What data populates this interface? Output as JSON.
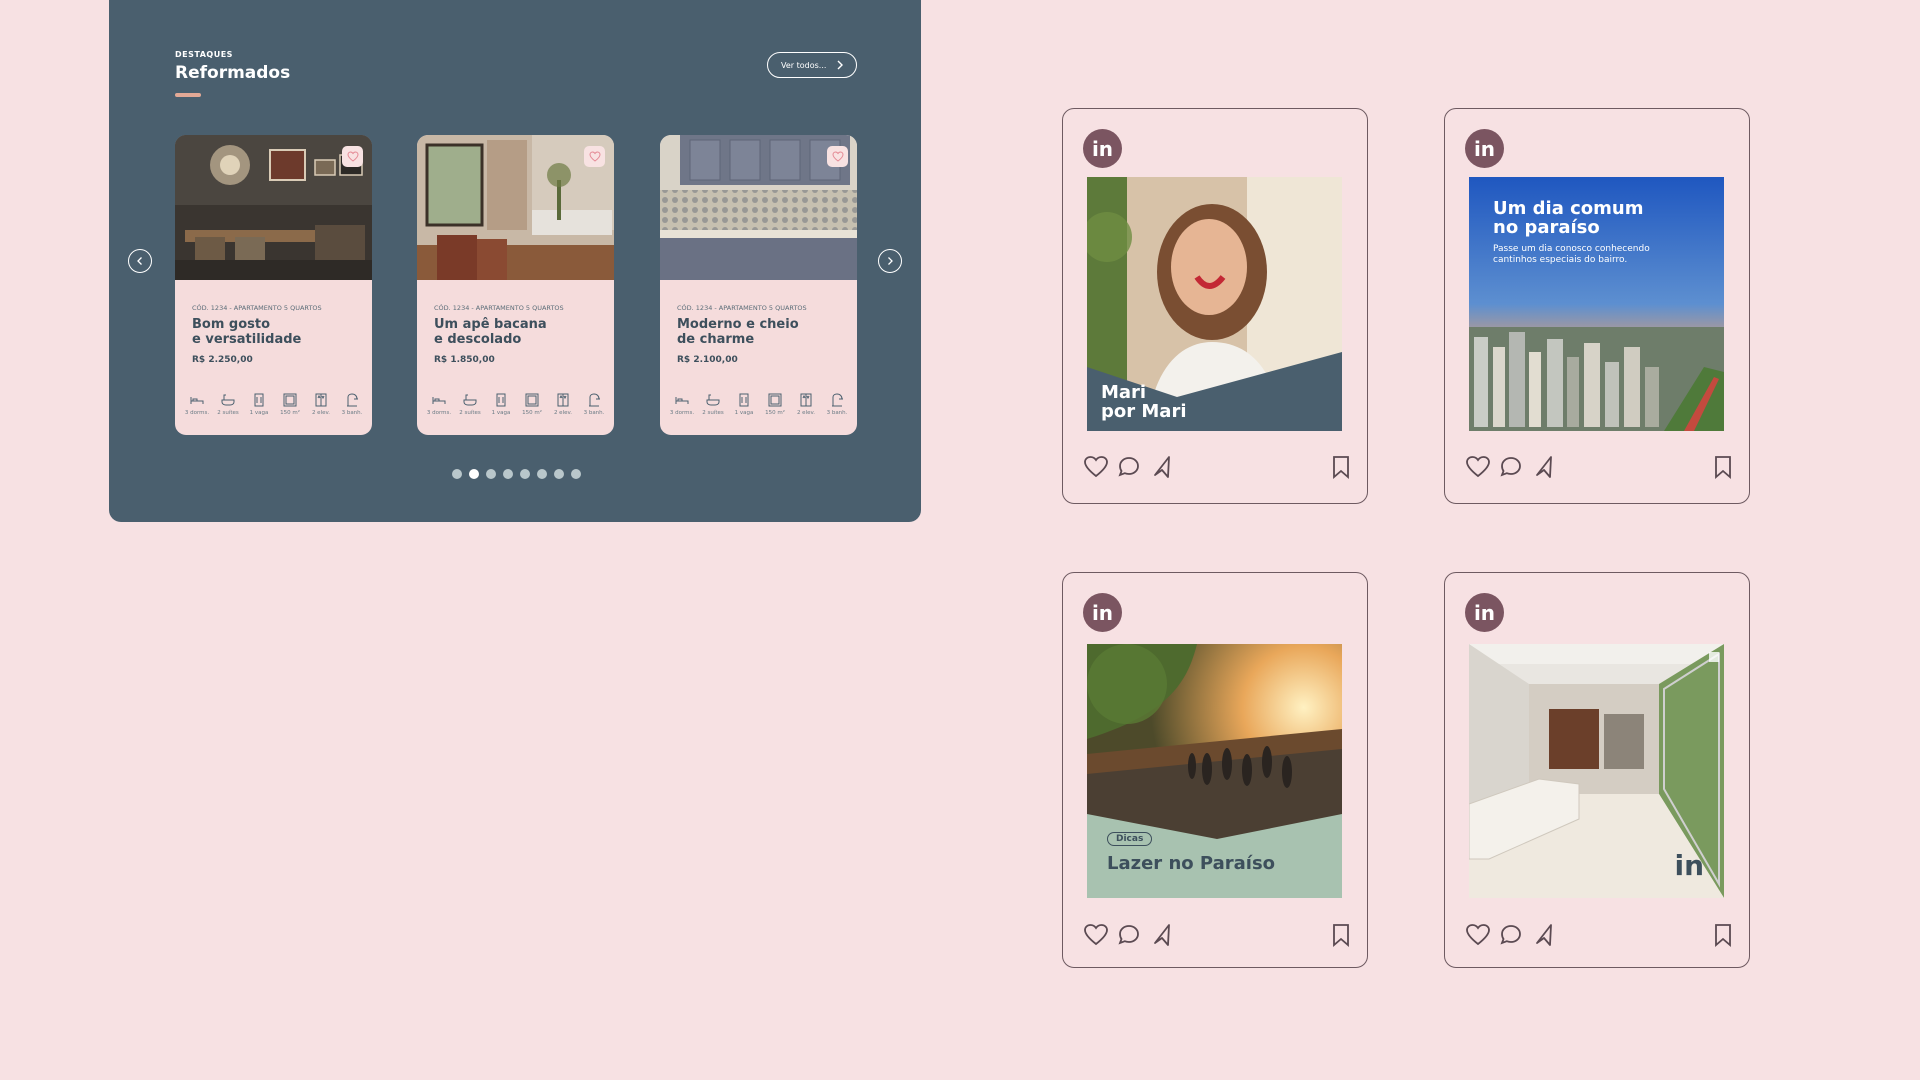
{
  "website": {
    "eyebrow": "DESTAQUES",
    "title": "Reformados",
    "see_all": "Ver todos...",
    "cards": [
      {
        "code": "CÓD. 1234  -  APARTAMENTO 5 QUARTOS",
        "title": "Bom gosto\ne versatilidade",
        "price": "R$ 2.250,00"
      },
      {
        "code": "CÓD. 1234  -  APARTAMENTO 5 QUARTOS",
        "title": "Um apê bacana\ne descolado",
        "price": "R$ 1.850,00"
      },
      {
        "code": "CÓD. 1234  -  APARTAMENTO 5 QUARTOS",
        "title": "Moderno e cheio\nde charme",
        "price": "R$ 2.100,00"
      }
    ],
    "features": [
      "3 dorms.",
      "2 suítes",
      "1 vaga",
      "150 m²",
      "2 elev.",
      "3 banh."
    ],
    "pagination": {
      "total": 8,
      "active": 2
    }
  },
  "posts": [
    {
      "logo": "in",
      "title": "Mari\npor Mari"
    },
    {
      "logo": "in",
      "title": "Um dia comum\nno paraíso",
      "subtitle": "Passe um dia conosco conhecendo\ncantinhos especiais do bairro."
    },
    {
      "logo": "in",
      "tag": "Dicas",
      "title": "Lazer no Paraíso"
    },
    {
      "logo": "in",
      "watermark": "in"
    }
  ],
  "colors": {
    "background": "#f7e1e3",
    "panel": "#4a5f6e",
    "accent": "#e3a996",
    "brand": "#7b5561"
  }
}
